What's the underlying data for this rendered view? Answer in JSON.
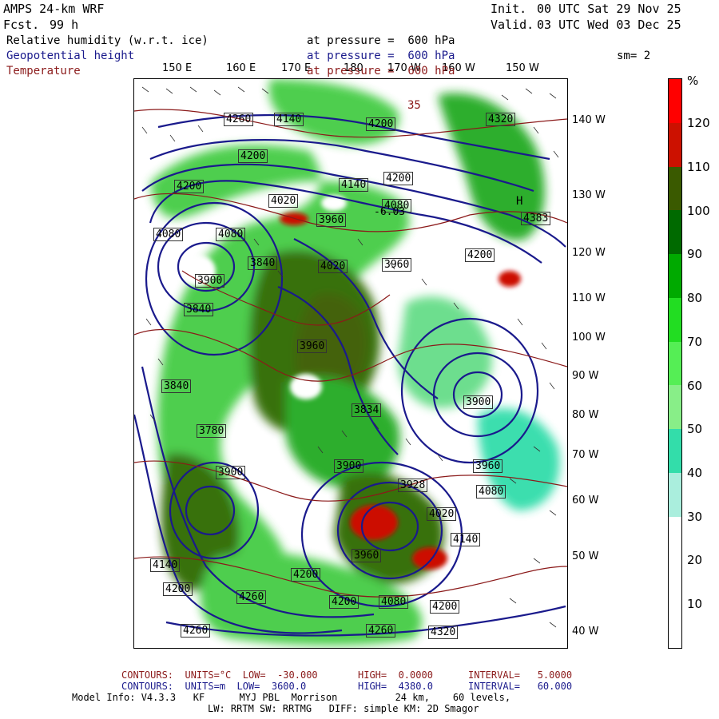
{
  "header": {
    "model": "AMPS 24-km WRF",
    "fcst_label": "Fcst.",
    "fcst_value": "99 h",
    "init_label": "Init.",
    "init_value": "00 UTC Sat 29 Nov 25",
    "valid_label": "Valid.",
    "valid_value": "03 UTC Wed 03 Dec 25",
    "fields": [
      {
        "name": "Relative humidity (w.r.t. ice)",
        "level": "at pressure =  600 hPa",
        "color": "#000000"
      },
      {
        "name": "Geopotential height",
        "level": "at pressure =  600 hPa",
        "color": "#1a1a8c"
      },
      {
        "name": "Temperature",
        "level": "at pressure =  600 hPa",
        "color": "#8b1a1a"
      }
    ],
    "smoothing": "sm= 2"
  },
  "longitude_labels_top": [
    "150 E",
    "160 E",
    "170 E",
    "180",
    "170 W",
    "160 W",
    "150 W"
  ],
  "longitude_labels_right": [
    "140 W",
    "130 W",
    "120 W",
    "110 W",
    "100 W",
    "90 W",
    "80 W",
    "70 W",
    "60 W",
    "50 W",
    "40 W"
  ],
  "colorbar": {
    "unit": "%",
    "labels": [
      "120",
      "110",
      "100",
      "90",
      "80",
      "70",
      "60",
      "50",
      "40",
      "30",
      "20",
      "10"
    ],
    "colors": [
      "#ff0000",
      "#cc1100",
      "#3a5a00",
      "#006a00",
      "#00aa00",
      "#22dd22",
      "#55ee55",
      "#88ee88",
      "#33ddaa",
      "#aaeedd",
      "#ffffff",
      "#ffffff",
      "#ffffff"
    ]
  },
  "height_labels": [
    "4260",
    "4140",
    "4320",
    "4200",
    "4200",
    "4200",
    "4200",
    "4140",
    "4080",
    "4020",
    "3960",
    "4080",
    "4080",
    "3840",
    "4200",
    "3960",
    "3900",
    "3840",
    "4020",
    "3960",
    "3840",
    "3900",
    "3834",
    "3780",
    "3900",
    "3960",
    "3900",
    "3928",
    "4020",
    "4080",
    "4140",
    "3960",
    "4200",
    "4260",
    "4200",
    "4260",
    "4200",
    "4080",
    "4320",
    "4200",
    "4260",
    "4140",
    "4383"
  ],
  "map_annotations": {
    "h_label": "H",
    "h_value": "4383",
    "t_value": "35",
    "low_value": "-6.03"
  },
  "footer": {
    "line1": {
      "label": "CONTOURS:  UNITS=°C  LOW=  -30.000",
      "high": "HIGH=  0.0000",
      "interval": "INTERVAL=   5.0000"
    },
    "line2": {
      "label": "CONTOURS:  UNITS=m  LOW=  3600.0",
      "high": "HIGH=  4380.0",
      "interval": "INTERVAL=   60.000"
    },
    "line3": "Model Info: V4.3.3   KF      MYJ PBL  Morrison          24 km,    60 levels,",
    "line4": "LW: RRTM SW: RRTMG   DIFF: simple KM: 2D Smagor"
  }
}
